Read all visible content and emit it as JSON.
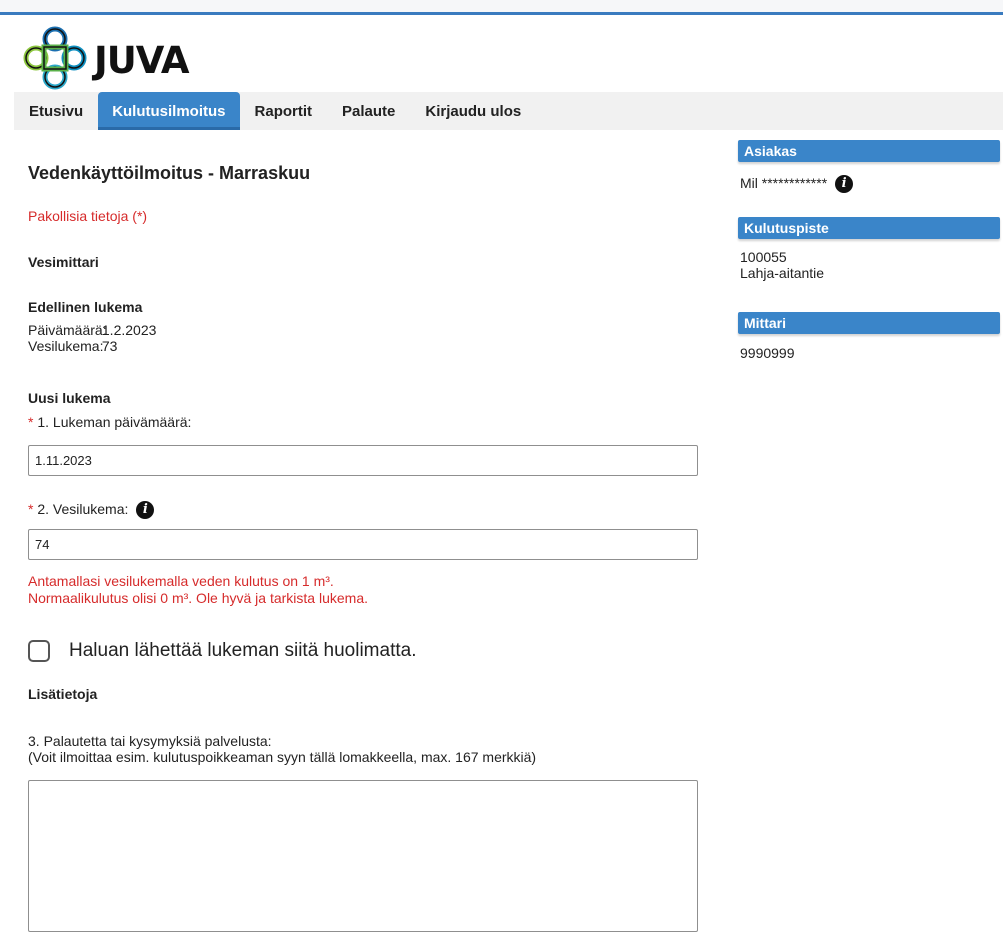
{
  "app": {
    "logo_text": "JUVA"
  },
  "nav": {
    "items": [
      {
        "label": "Etusivu",
        "active": false
      },
      {
        "label": "Kulutusilmoitus",
        "active": true
      },
      {
        "label": "Raportit",
        "active": false
      },
      {
        "label": "Palaute",
        "active": false
      },
      {
        "label": "Kirjaudu ulos",
        "active": false
      }
    ]
  },
  "form": {
    "title": "Vedenkäyttöilmoitus - Marraskuu",
    "required_note": "Pakollisia tietoja (*)",
    "section_meter": "Vesimittari",
    "previous": {
      "heading": "Edellinen lukema",
      "date_label": "Päivämäärä:",
      "date_value": "1.2.2023",
      "reading_label": "Vesilukema:",
      "reading_value": "73"
    },
    "new_reading": {
      "heading": "Uusi lukema",
      "required_marker": "*",
      "date_label": "1. Lukeman päivämäärä:",
      "date_value": "1.11.2023",
      "reading_label": "2. Vesilukema:",
      "reading_value": "74"
    },
    "warning": {
      "line1": "Antamallasi vesilukemalla veden kulutus on 1 m³.",
      "line2": "Normaalikulutus olisi 0 m³. Ole hyvä ja tarkista lukema."
    },
    "confirm_checkbox": {
      "label": "Haluan lähettää lukeman siitä huolimatta.",
      "checked": false
    },
    "additional": {
      "heading": "Lisätietoja",
      "feedback_label_line1": "3. Palautetta tai kysymyksiä palvelusta:",
      "feedback_label_line2": "(Voit ilmoittaa esim. kulutuspoikkeaman syyn tällä lomakkeella, max. 167 merkkiä)",
      "feedback_value": ""
    }
  },
  "sidebar": {
    "customer": {
      "heading": "Asiakas",
      "value": "Mil ************"
    },
    "consumption_point": {
      "heading": "Kulutuspiste",
      "id": "100055",
      "address": "Lahja-aitantie"
    },
    "meter": {
      "heading": "Mittari",
      "value": "9990999"
    }
  },
  "colors": {
    "accent": "#3a85c9",
    "warning": "#d62b2b",
    "topline": "#3a7bbf"
  }
}
